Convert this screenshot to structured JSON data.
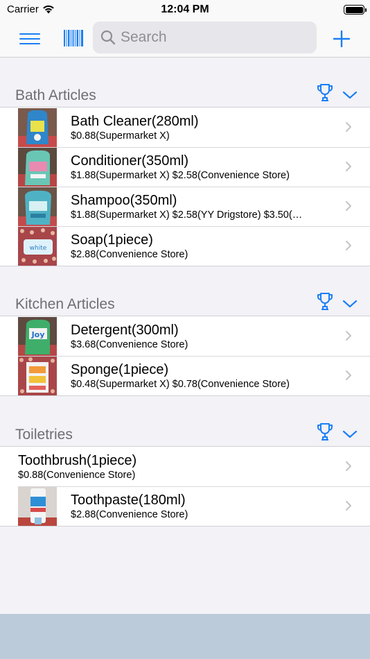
{
  "status_bar": {
    "carrier": "Carrier",
    "time": "12:04 PM"
  },
  "nav": {
    "menu_icon": "hamburger-menu-icon",
    "barcode_icon": "barcode-scan-icon",
    "search_placeholder": "Search",
    "search_value": "",
    "add_icon": "plus-icon"
  },
  "colors": {
    "accent": "#1a7ef5",
    "background": "#f2f2f7",
    "section_title": "#6e6e73",
    "footer": "#bccbda"
  },
  "sections": [
    {
      "title": "Bath Articles",
      "items": [
        {
          "name": "Bath Cleaner(280ml)",
          "price": "$0.88(Supermarket X)"
        },
        {
          "name": "Conditioner(350ml)",
          "price": "$1.88(Supermarket X) $2.58(Convenience Store)"
        },
        {
          "name": "Shampoo(350ml)",
          "price": "$1.88(Supermarket X) $2.58(YY Drigstore) $3.50(…"
        },
        {
          "name": "Soap(1piece)",
          "price": "$2.88(Convenience Store)"
        }
      ]
    },
    {
      "title": "Kitchen Articles",
      "items": [
        {
          "name": "Detergent(300ml)",
          "price": "$3.68(Convenience Store)"
        },
        {
          "name": "Sponge(1piece)",
          "price": "$0.48(Supermarket X) $0.78(Convenience Store)"
        }
      ]
    },
    {
      "title": "Toiletries",
      "items": [
        {
          "name": "Toothbrush(1piece)",
          "price": "$0.88(Convenience Store)"
        },
        {
          "name": "Toothpaste(180ml)",
          "price": "$2.88(Convenience Store)"
        }
      ]
    }
  ]
}
